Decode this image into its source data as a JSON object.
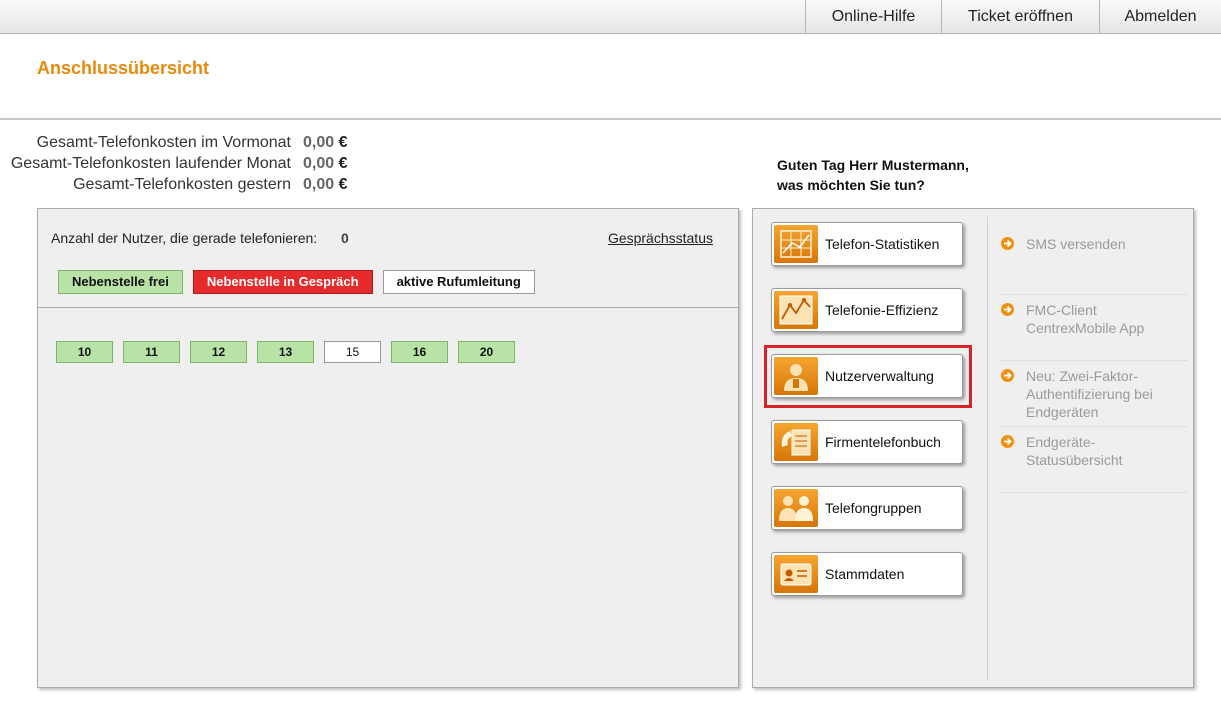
{
  "topnav": {
    "help": "Online-Hilfe",
    "ticket": "Ticket eröffnen",
    "logout": "Abmelden"
  },
  "page": {
    "title": "Anschlussübersicht"
  },
  "costs": [
    {
      "label": "Gesamt-Telefonkosten im Vormonat",
      "value": "0,00",
      "currency": "€"
    },
    {
      "label": "Gesamt-Telefonkosten laufender Monat",
      "value": "0,00",
      "currency": "€"
    },
    {
      "label": "Gesamt-Telefonkosten gestern",
      "value": "0,00",
      "currency": "€"
    }
  ],
  "greeting": {
    "line1": "Guten Tag Herr Mustermann,",
    "line2": "was möchten Sie tun?"
  },
  "status_panel": {
    "users_label": "Anzahl der Nutzer, die gerade telefonieren:",
    "users_count": "0",
    "status_link": "Gesprächsstatus",
    "legend": {
      "free": "Nebenstelle frei",
      "busy": "Nebenstelle in Gespräch",
      "forward": "aktive Rufumleitung"
    },
    "extensions": [
      {
        "number": "10",
        "state": "free"
      },
      {
        "number": "11",
        "state": "free"
      },
      {
        "number": "12",
        "state": "free"
      },
      {
        "number": "13",
        "state": "free"
      },
      {
        "number": "15",
        "state": "idle"
      },
      {
        "number": "16",
        "state": "free"
      },
      {
        "number": "20",
        "state": "free"
      }
    ]
  },
  "actions": [
    {
      "label": "Telefon-Statistiken",
      "icon": "statistics-grid-icon"
    },
    {
      "label": "Telefonie-Effizienz",
      "icon": "efficiency-chart-icon"
    },
    {
      "label": "Nutzerverwaltung",
      "icon": "user-management-icon",
      "highlighted": true
    },
    {
      "label": "Firmentelefonbuch",
      "icon": "phonebook-icon"
    },
    {
      "label": "Telefongruppen",
      "icon": "phone-group-icon"
    },
    {
      "label": "Stammdaten",
      "icon": "id-card-icon"
    }
  ],
  "links": [
    {
      "text": "SMS versenden",
      "icon": "arrow-circle-icon"
    },
    {
      "text": "FMC-Client CentrexMobile App",
      "icon": "arrow-circle-icon"
    },
    {
      "text": "Neu: Zwei-Faktor-Authentifizierung bei Endgeräten",
      "icon": "arrow-circle-icon"
    },
    {
      "text": "Endgeräte-Statusübersicht",
      "icon": "arrow-circle-icon"
    }
  ],
  "colors": {
    "accent": "#e8890c",
    "free": "#b8e2a6",
    "busy": "#e52b2b",
    "highlight": "#d8222a"
  }
}
